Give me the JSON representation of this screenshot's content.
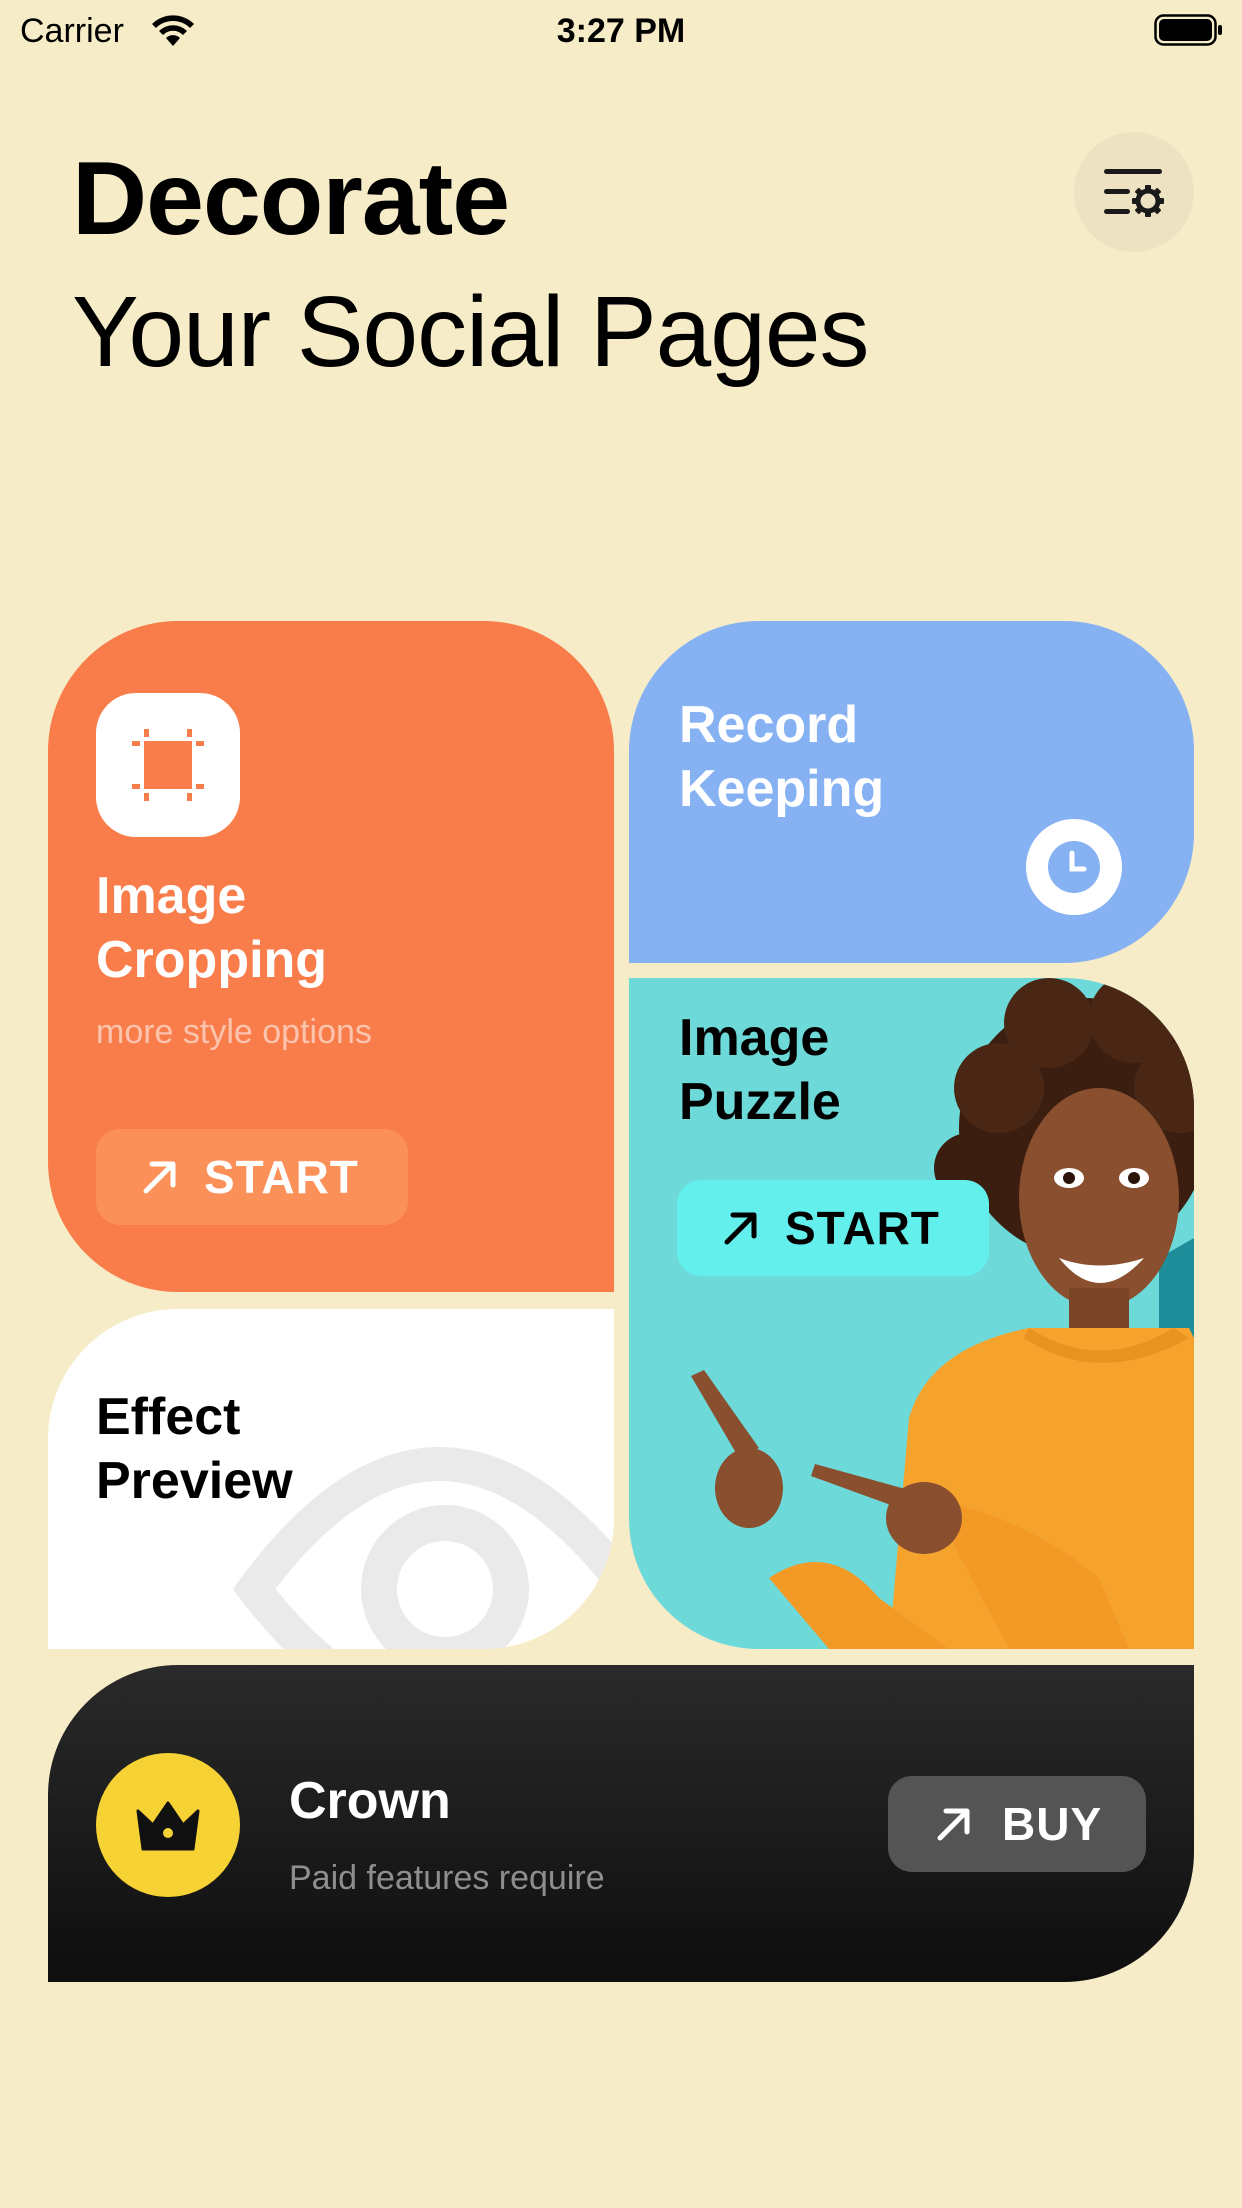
{
  "status_bar": {
    "carrier": "Carrier",
    "time": "3:27 PM"
  },
  "header": {
    "title_bold": "Decorate",
    "title_regular": "Your Social Pages",
    "settings_icon": "settings-list-icon"
  },
  "cards": {
    "image_cropping": {
      "title_line1": "Image",
      "title_line2": "Cropping",
      "subtitle": "more style options",
      "button_label": "START",
      "icon": "crop-icon",
      "color": "#F97D4B"
    },
    "record_keeping": {
      "title_line1": "Record",
      "title_line2": "Keeping",
      "icon": "clock-icon",
      "color": "#86B2F3"
    },
    "image_puzzle": {
      "title_line1": "Image",
      "title_line2": "Puzzle",
      "button_label": "START",
      "color": "#6DD9D9"
    },
    "effect_preview": {
      "title_line1": "Effect",
      "title_line2": "Preview",
      "icon": "eye-icon",
      "color": "#FFFFFF"
    }
  },
  "premium": {
    "title": "Crown",
    "subtitle": "Paid features require",
    "button_label": "BUY",
    "icon": "crown-icon",
    "accent": "#F7D234"
  },
  "colors": {
    "background": "#F6ECC7"
  }
}
